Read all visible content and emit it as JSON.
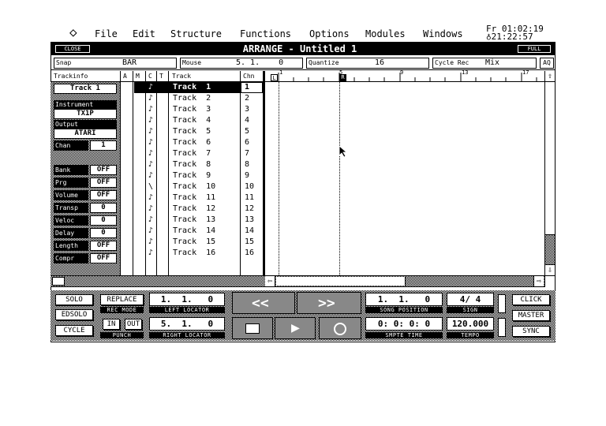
{
  "menu": {
    "items": [
      "File",
      "Edit",
      "Structure",
      "Functions",
      "Options",
      "Modules",
      "Windows"
    ],
    "clock_line1": "Fr 01:02:19",
    "clock_line2": "21:22:57"
  },
  "window": {
    "title": "ARRANGE - Untitled 1",
    "close_label": "CLOSE",
    "full_label": "FULL"
  },
  "infobar": {
    "snap_label": "Snap",
    "snap_value": "BAR",
    "mouse_label": "Mouse",
    "mouse_value": "5. 1.    0",
    "quantize_label": "Quantize",
    "quantize_value": "16",
    "cycle_label": "Cycle Rec",
    "cycle_value": "Mix",
    "aq_label": "AQ"
  },
  "headers": {
    "trackinfo": "Trackinfo",
    "a": "A",
    "m": "M",
    "c": "C",
    "t": "T",
    "track": "Track",
    "chn": "Chn"
  },
  "ruler": {
    "marks": [
      "1",
      "5",
      "9",
      "13",
      "17"
    ],
    "left_marker": "L",
    "right_marker": "R"
  },
  "inspector": {
    "track_name": "Track 1",
    "instrument_label": "Instrument",
    "instrument_value": "TX1P",
    "output_label": "Output",
    "output_value": "ATARI",
    "chan_label": "Chan",
    "chan_value": "1",
    "params": [
      {
        "label": "Bank",
        "value": "OFF"
      },
      {
        "label": "Prg",
        "value": "OFF"
      },
      {
        "label": "Volume",
        "value": "OFF"
      },
      {
        "label": "Transp",
        "value": "0"
      },
      {
        "label": "Veloc",
        "value": "0"
      },
      {
        "label": "Delay",
        "value": "0"
      },
      {
        "label": "Length",
        "value": "OFF"
      },
      {
        "label": "Compr",
        "value": "OFF"
      }
    ]
  },
  "tracks": [
    {
      "name": "Track  1",
      "chn": "1",
      "icon": "♪"
    },
    {
      "name": "Track  2",
      "chn": "2",
      "icon": "♪"
    },
    {
      "name": "Track  3",
      "chn": "3",
      "icon": "♪"
    },
    {
      "name": "Track  4",
      "chn": "4",
      "icon": "♪"
    },
    {
      "name": "Track  5",
      "chn": "5",
      "icon": "♪"
    },
    {
      "name": "Track  6",
      "chn": "6",
      "icon": "♪"
    },
    {
      "name": "Track  7",
      "chn": "7",
      "icon": "♪"
    },
    {
      "name": "Track  8",
      "chn": "8",
      "icon": "♪"
    },
    {
      "name": "Track  9",
      "chn": "9",
      "icon": "♪"
    },
    {
      "name": "Track  10",
      "chn": "10",
      "icon": "\\"
    },
    {
      "name": "Track  11",
      "chn": "11",
      "icon": "♪"
    },
    {
      "name": "Track  12",
      "chn": "12",
      "icon": "♪"
    },
    {
      "name": "Track  13",
      "chn": "13",
      "icon": "♪"
    },
    {
      "name": "Track  14",
      "chn": "14",
      "icon": "♪"
    },
    {
      "name": "Track  15",
      "chn": "15",
      "icon": "♪"
    },
    {
      "name": "Track  16",
      "chn": "16",
      "icon": "♪"
    }
  ],
  "transport": {
    "solo": "SOLO",
    "replace": "REPLACE",
    "rec_mode": "REC MODE",
    "edsolo": "EDSOLO",
    "cycle": "CYCLE",
    "in": "IN",
    "out": "OUT",
    "punch": "PUNCH",
    "left_locator_value": "1.  1.   0",
    "left_locator_label": "LEFT LOCATOR",
    "right_locator_value": "5.  1.   0",
    "right_locator_label": "RIGHT LOCATOR",
    "song_position_value": "1.  1.   0",
    "song_position_label": "SONG POSITION",
    "smpte_value": "0: 0: 0: 0",
    "smpte_label": "SMPTE TIME",
    "sign_value": "4/ 4",
    "sign_label": "SIGN",
    "tempo_value": "120.000",
    "tempo_label": "TEMPO",
    "click": "CLICK",
    "master": "MASTER",
    "sync": "SYNC",
    "rewind_icon": "<<",
    "forward_icon": ">>"
  }
}
